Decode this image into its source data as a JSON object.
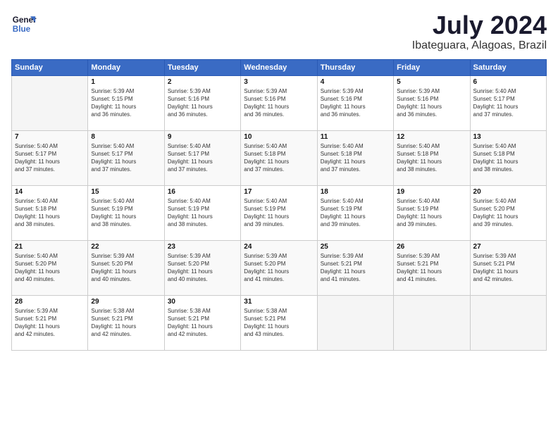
{
  "logo": {
    "line1": "General",
    "line2": "Blue"
  },
  "title": "July 2024",
  "location": "Ibateguara, Alagoas, Brazil",
  "days_of_week": [
    "Sunday",
    "Monday",
    "Tuesday",
    "Wednesday",
    "Thursday",
    "Friday",
    "Saturday"
  ],
  "weeks": [
    [
      {
        "day": "",
        "info": ""
      },
      {
        "day": "1",
        "info": "Sunrise: 5:39 AM\nSunset: 5:15 PM\nDaylight: 11 hours\nand 36 minutes."
      },
      {
        "day": "2",
        "info": "Sunrise: 5:39 AM\nSunset: 5:16 PM\nDaylight: 11 hours\nand 36 minutes."
      },
      {
        "day": "3",
        "info": "Sunrise: 5:39 AM\nSunset: 5:16 PM\nDaylight: 11 hours\nand 36 minutes."
      },
      {
        "day": "4",
        "info": "Sunrise: 5:39 AM\nSunset: 5:16 PM\nDaylight: 11 hours\nand 36 minutes."
      },
      {
        "day": "5",
        "info": "Sunrise: 5:39 AM\nSunset: 5:16 PM\nDaylight: 11 hours\nand 36 minutes."
      },
      {
        "day": "6",
        "info": "Sunrise: 5:40 AM\nSunset: 5:17 PM\nDaylight: 11 hours\nand 37 minutes."
      }
    ],
    [
      {
        "day": "7",
        "info": "Sunrise: 5:40 AM\nSunset: 5:17 PM\nDaylight: 11 hours\nand 37 minutes."
      },
      {
        "day": "8",
        "info": "Sunrise: 5:40 AM\nSunset: 5:17 PM\nDaylight: 11 hours\nand 37 minutes."
      },
      {
        "day": "9",
        "info": "Sunrise: 5:40 AM\nSunset: 5:17 PM\nDaylight: 11 hours\nand 37 minutes."
      },
      {
        "day": "10",
        "info": "Sunrise: 5:40 AM\nSunset: 5:18 PM\nDaylight: 11 hours\nand 37 minutes."
      },
      {
        "day": "11",
        "info": "Sunrise: 5:40 AM\nSunset: 5:18 PM\nDaylight: 11 hours\nand 37 minutes."
      },
      {
        "day": "12",
        "info": "Sunrise: 5:40 AM\nSunset: 5:18 PM\nDaylight: 11 hours\nand 38 minutes."
      },
      {
        "day": "13",
        "info": "Sunrise: 5:40 AM\nSunset: 5:18 PM\nDaylight: 11 hours\nand 38 minutes."
      }
    ],
    [
      {
        "day": "14",
        "info": "Sunrise: 5:40 AM\nSunset: 5:18 PM\nDaylight: 11 hours\nand 38 minutes."
      },
      {
        "day": "15",
        "info": "Sunrise: 5:40 AM\nSunset: 5:19 PM\nDaylight: 11 hours\nand 38 minutes."
      },
      {
        "day": "16",
        "info": "Sunrise: 5:40 AM\nSunset: 5:19 PM\nDaylight: 11 hours\nand 38 minutes."
      },
      {
        "day": "17",
        "info": "Sunrise: 5:40 AM\nSunset: 5:19 PM\nDaylight: 11 hours\nand 39 minutes."
      },
      {
        "day": "18",
        "info": "Sunrise: 5:40 AM\nSunset: 5:19 PM\nDaylight: 11 hours\nand 39 minutes."
      },
      {
        "day": "19",
        "info": "Sunrise: 5:40 AM\nSunset: 5:19 PM\nDaylight: 11 hours\nand 39 minutes."
      },
      {
        "day": "20",
        "info": "Sunrise: 5:40 AM\nSunset: 5:20 PM\nDaylight: 11 hours\nand 39 minutes."
      }
    ],
    [
      {
        "day": "21",
        "info": "Sunrise: 5:40 AM\nSunset: 5:20 PM\nDaylight: 11 hours\nand 40 minutes."
      },
      {
        "day": "22",
        "info": "Sunrise: 5:39 AM\nSunset: 5:20 PM\nDaylight: 11 hours\nand 40 minutes."
      },
      {
        "day": "23",
        "info": "Sunrise: 5:39 AM\nSunset: 5:20 PM\nDaylight: 11 hours\nand 40 minutes."
      },
      {
        "day": "24",
        "info": "Sunrise: 5:39 AM\nSunset: 5:20 PM\nDaylight: 11 hours\nand 41 minutes."
      },
      {
        "day": "25",
        "info": "Sunrise: 5:39 AM\nSunset: 5:21 PM\nDaylight: 11 hours\nand 41 minutes."
      },
      {
        "day": "26",
        "info": "Sunrise: 5:39 AM\nSunset: 5:21 PM\nDaylight: 11 hours\nand 41 minutes."
      },
      {
        "day": "27",
        "info": "Sunrise: 5:39 AM\nSunset: 5:21 PM\nDaylight: 11 hours\nand 42 minutes."
      }
    ],
    [
      {
        "day": "28",
        "info": "Sunrise: 5:39 AM\nSunset: 5:21 PM\nDaylight: 11 hours\nand 42 minutes."
      },
      {
        "day": "29",
        "info": "Sunrise: 5:38 AM\nSunset: 5:21 PM\nDaylight: 11 hours\nand 42 minutes."
      },
      {
        "day": "30",
        "info": "Sunrise: 5:38 AM\nSunset: 5:21 PM\nDaylight: 11 hours\nand 42 minutes."
      },
      {
        "day": "31",
        "info": "Sunrise: 5:38 AM\nSunset: 5:21 PM\nDaylight: 11 hours\nand 43 minutes."
      },
      {
        "day": "",
        "info": ""
      },
      {
        "day": "",
        "info": ""
      },
      {
        "day": "",
        "info": ""
      }
    ]
  ]
}
